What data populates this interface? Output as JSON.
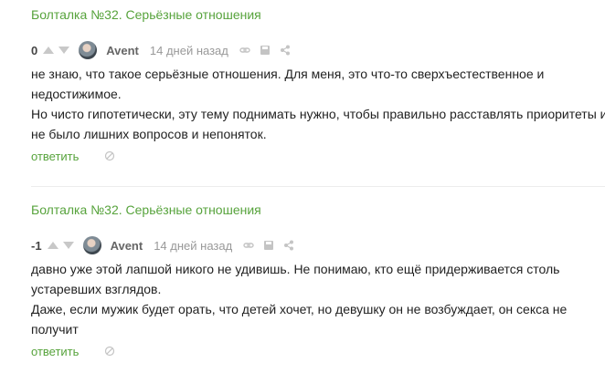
{
  "comments": [
    {
      "post_title": "Болталка №32. Серьёзные отношения",
      "rating": "0",
      "author": "Avent",
      "time": "14 дней назад",
      "lines": [
        "не знаю, что такое серьёзные отношения. Для меня, это что-то сверхъестественное и",
        "недостижимое.",
        "Но чисто гипотетически, эту тему поднимать нужно, чтобы правильно расставлять приоритеты и",
        "не было лишних вопросов и непоняток."
      ],
      "reply_label": "ответить"
    },
    {
      "post_title": "Болталка №32. Серьёзные отношения",
      "rating": "-1",
      "author": "Avent",
      "time": "14 дней назад",
      "lines": [
        "давно уже этой лапшой никого не удивишь. Не понимаю, кто ещё придерживается столь",
        "устаревших взглядов.",
        "Даже, если мужик будет орать, что детей хочет, но девушку он не возбуждает, он секса не",
        "получит"
      ],
      "reply_label": "ответить"
    }
  ],
  "icons": {
    "vote_up": "arrow-up-icon",
    "vote_down": "arrow-down-icon",
    "link": "link-icon",
    "save": "save-icon",
    "share": "share-icon",
    "hide": "hide-icon"
  },
  "colors": {
    "accent": "#57a33c",
    "muted": "#999999"
  }
}
